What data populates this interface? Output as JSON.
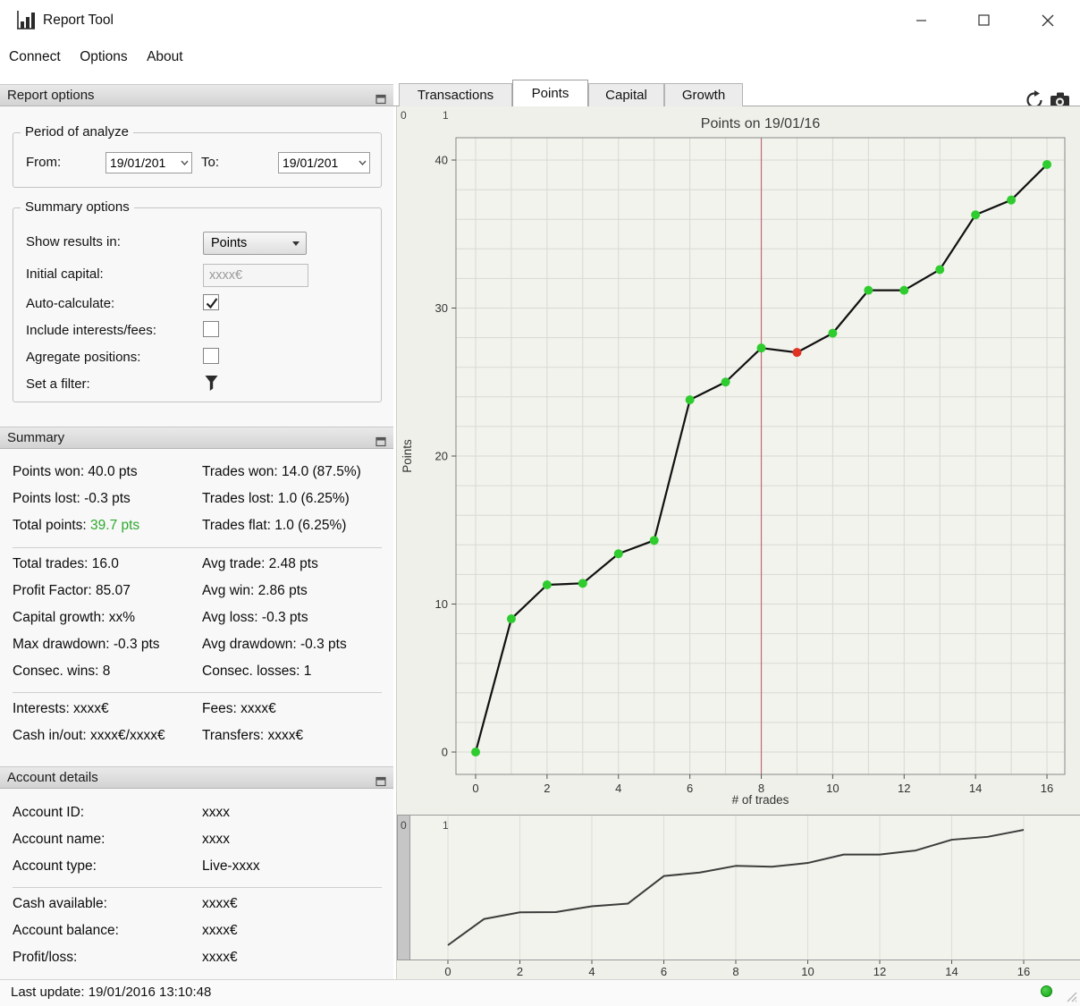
{
  "window": {
    "title": "Report Tool"
  },
  "menubar": {
    "items": [
      "Connect",
      "Options",
      "About"
    ]
  },
  "tabs": {
    "items": [
      "Transactions",
      "Points",
      "Capital",
      "Growth"
    ],
    "active": "Points"
  },
  "report_options": {
    "title": "Report options",
    "period": {
      "group_label": "Period of analyze",
      "from_label": "From:",
      "from_value": "19/01/201",
      "to_label": "To:",
      "to_value": "19/01/201"
    },
    "summary_options": {
      "group_label": "Summary options",
      "show_results": {
        "label": "Show results in:",
        "value": "Points"
      },
      "initial_capital": {
        "label": "Initial capital:",
        "placeholder": "xxxx€"
      },
      "auto_calculate": {
        "label": "Auto-calculate:",
        "checked": true
      },
      "include_interests": {
        "label": "Include interests/fees:",
        "checked": false
      },
      "agregate": {
        "label": "Agregate positions:",
        "checked": false
      },
      "filter": {
        "label": "Set a filter:"
      }
    }
  },
  "summary": {
    "title": "Summary",
    "block1": [
      {
        "left": "Points won: 40.0 pts",
        "right": "Trades won: 14.0 (87.5%)"
      },
      {
        "left": "Points lost: -0.3 pts",
        "right": "Trades lost: 1.0 (6.25%)"
      },
      {
        "left_label": "Total points: ",
        "left_value": "39.7 pts",
        "right": "Trades flat: 1.0 (6.25%)"
      }
    ],
    "block2": [
      {
        "left": "Total trades: 16.0",
        "right": "Avg trade: 2.48 pts"
      },
      {
        "left": "Profit Factor: 85.07",
        "right": "Avg win: 2.86 pts"
      },
      {
        "left": "Capital growth: xx%",
        "right": "Avg loss: -0.3 pts"
      },
      {
        "left": "Max drawdown: -0.3 pts",
        "right": "Avg drawdown: -0.3 pts"
      },
      {
        "left": "Consec. wins: 8",
        "right": "Consec. losses: 1"
      }
    ],
    "block3": [
      {
        "left": "Interests: xxxx€",
        "right": "Fees: xxxx€"
      },
      {
        "left": "Cash in/out: xxxx€/xxxx€",
        "right": "Transfers: xxxx€"
      }
    ]
  },
  "account_details": {
    "title": "Account details",
    "block1": [
      {
        "label": "Account ID:",
        "value": "xxxx"
      },
      {
        "label": "Account name:",
        "value": "xxxx"
      },
      {
        "label": "Account type:",
        "value": "Live-xxxx"
      }
    ],
    "block2": [
      {
        "label": "Cash available:",
        "value": "xxxx€"
      },
      {
        "label": "Account balance:",
        "value": "xxxx€"
      },
      {
        "label": "Profit/loss:",
        "value": "xxxx€"
      }
    ]
  },
  "statusbar": {
    "last_update": "Last update: 19/01/2016 13:10:48",
    "status_color": "#24b324"
  },
  "colors": {
    "positive_text": "#2da82d",
    "win_marker": "#2ecc2e",
    "loss_marker": "#e03123",
    "cursor_line": "#c4687a"
  },
  "chart_data": {
    "type": "line",
    "title": "Points on 19/01/16",
    "xlabel": "# of trades",
    "ylabel": "Points",
    "x": [
      0,
      1,
      2,
      3,
      4,
      5,
      6,
      7,
      8,
      9,
      10,
      11,
      12,
      13,
      14,
      15,
      16
    ],
    "y": [
      0,
      9.0,
      11.3,
      11.4,
      13.4,
      14.3,
      23.8,
      25.0,
      27.3,
      27.0,
      28.3,
      31.2,
      31.2,
      32.6,
      36.3,
      37.3,
      39.7
    ],
    "point_colors": [
      "#2ecc2e",
      "#2ecc2e",
      "#2ecc2e",
      "#2ecc2e",
      "#2ecc2e",
      "#2ecc2e",
      "#2ecc2e",
      "#2ecc2e",
      "#2ecc2e",
      "#e03123",
      "#2ecc2e",
      "#2ecc2e",
      "#2ecc2e",
      "#2ecc2e",
      "#2ecc2e",
      "#2ecc2e",
      "#2ecc2e"
    ],
    "xticks": [
      0,
      2,
      4,
      6,
      8,
      10,
      12,
      14,
      16
    ],
    "yticks": [
      0,
      10,
      20,
      30,
      40
    ],
    "xlim": [
      -0.55,
      16.5
    ],
    "ylim": [
      -1.5,
      41.5
    ],
    "grid": true,
    "vline_x": 8,
    "vline_color": "#c4687a",
    "line_color": "#111111",
    "range_labels": [
      "0",
      "1"
    ],
    "overview": {
      "line_color": "#3c3c3c",
      "xticks": [
        0,
        2,
        4,
        6,
        8,
        10,
        12,
        14,
        16
      ]
    }
  }
}
